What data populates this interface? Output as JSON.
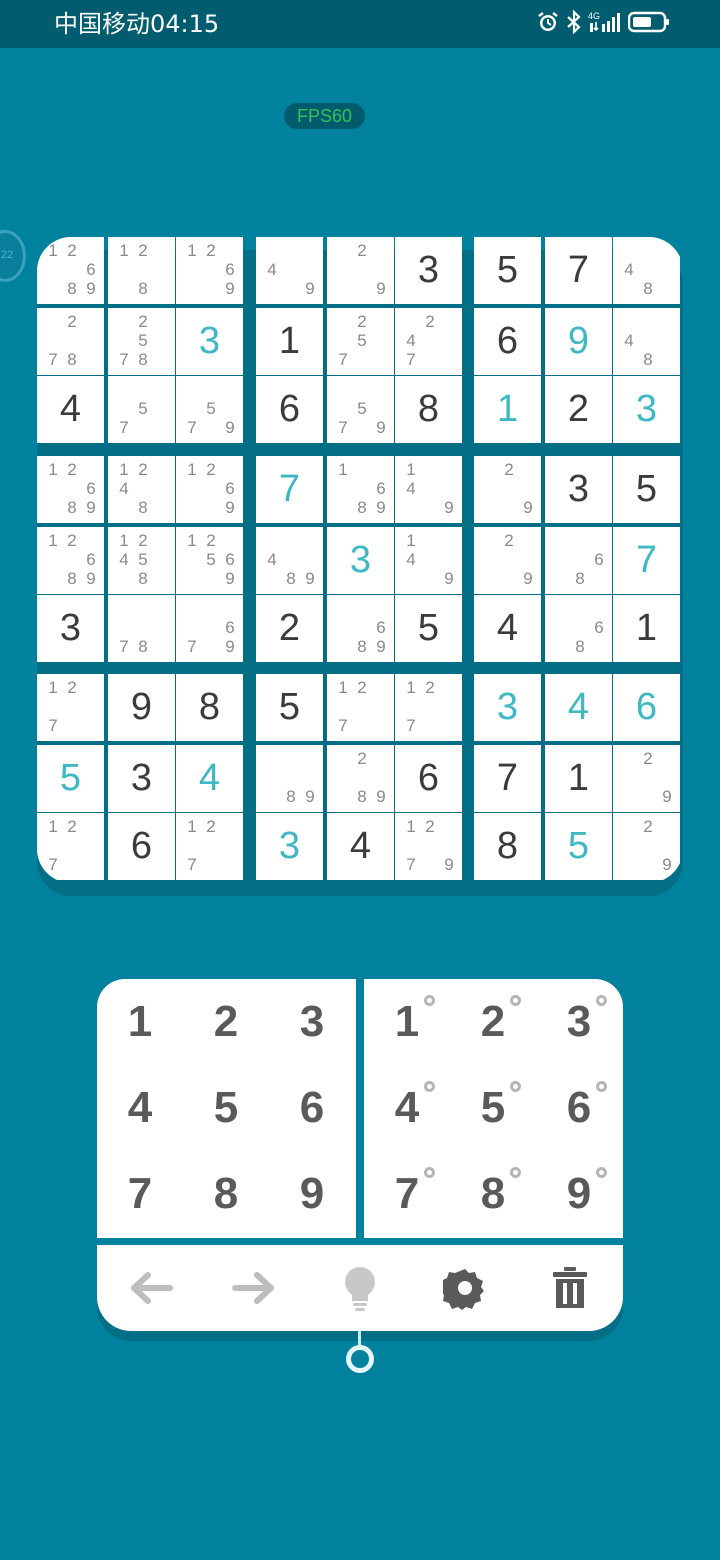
{
  "status_bar": {
    "carrier_time": "中国移动04:15",
    "icons": [
      "alarm-icon",
      "bluetooth-icon",
      "signal-4g-icon",
      "battery-icon"
    ],
    "network": "4G"
  },
  "fps_badge": "FPS60",
  "colors": {
    "background": "#00829f",
    "entered": "#3db8c4",
    "given": "#3b3b3b",
    "note": "#8a8a8a"
  },
  "board": {
    "rows": [
      [
        {
          "n": [
            1,
            2,
            6,
            8,
            9
          ]
        },
        {
          "n": [
            1,
            2,
            8
          ]
        },
        {
          "n": [
            1,
            2,
            6,
            9
          ]
        },
        {
          "n": [
            4,
            9
          ]
        },
        {
          "n": [
            2,
            9
          ]
        },
        {
          "v": "3",
          "t": "g"
        },
        {
          "v": "5",
          "t": "g"
        },
        {
          "v": "7",
          "t": "g"
        },
        {
          "n": [
            4,
            8
          ]
        }
      ],
      [
        {
          "n": [
            2,
            7,
            8
          ]
        },
        {
          "n": [
            2,
            5,
            7,
            8
          ]
        },
        {
          "v": "3",
          "t": "e"
        },
        {
          "v": "1",
          "t": "g"
        },
        {
          "n": [
            2,
            5,
            7
          ]
        },
        {
          "n": [
            2,
            4,
            7
          ]
        },
        {
          "v": "6",
          "t": "g"
        },
        {
          "v": "9",
          "t": "e"
        },
        {
          "n": [
            4,
            8
          ]
        }
      ],
      [
        {
          "v": "4",
          "t": "g"
        },
        {
          "n": [
            5,
            7
          ]
        },
        {
          "n": [
            5,
            7,
            9
          ]
        },
        {
          "v": "6",
          "t": "g"
        },
        {
          "n": [
            5,
            7,
            9
          ]
        },
        {
          "v": "8",
          "t": "g"
        },
        {
          "v": "1",
          "t": "e"
        },
        {
          "v": "2",
          "t": "g"
        },
        {
          "v": "3",
          "t": "e"
        }
      ],
      [
        {
          "n": [
            1,
            2,
            6,
            8,
            9
          ]
        },
        {
          "n": [
            1,
            2,
            4,
            8
          ]
        },
        {
          "n": [
            1,
            2,
            6,
            9
          ]
        },
        {
          "v": "7",
          "t": "e"
        },
        {
          "n": [
            1,
            6,
            8,
            9
          ]
        },
        {
          "n": [
            1,
            4,
            9
          ]
        },
        {
          "n": [
            2,
            9
          ]
        },
        {
          "v": "3",
          "t": "g"
        },
        {
          "v": "5",
          "t": "g"
        }
      ],
      [
        {
          "n": [
            1,
            2,
            6,
            8,
            9
          ]
        },
        {
          "n": [
            1,
            2,
            4,
            5,
            8
          ]
        },
        {
          "n": [
            1,
            2,
            5,
            6,
            9
          ]
        },
        {
          "n": [
            4,
            8,
            9
          ]
        },
        {
          "v": "3",
          "t": "e"
        },
        {
          "n": [
            1,
            4,
            9
          ]
        },
        {
          "n": [
            2,
            9
          ]
        },
        {
          "n": [
            6,
            8
          ]
        },
        {
          "v": "7",
          "t": "e"
        }
      ],
      [
        {
          "v": "3",
          "t": "g"
        },
        {
          "n": [
            7,
            8
          ]
        },
        {
          "n": [
            6,
            7,
            9
          ]
        },
        {
          "v": "2",
          "t": "g"
        },
        {
          "n": [
            6,
            8,
            9
          ]
        },
        {
          "v": "5",
          "t": "g"
        },
        {
          "v": "4",
          "t": "g"
        },
        {
          "n": [
            6,
            8
          ]
        },
        {
          "v": "1",
          "t": "g"
        }
      ],
      [
        {
          "n": [
            1,
            2,
            7
          ]
        },
        {
          "v": "9",
          "t": "g"
        },
        {
          "v": "8",
          "t": "g"
        },
        {
          "v": "5",
          "t": "g"
        },
        {
          "n": [
            1,
            2,
            7
          ]
        },
        {
          "n": [
            1,
            2,
            7
          ]
        },
        {
          "v": "3",
          "t": "e"
        },
        {
          "v": "4",
          "t": "e"
        },
        {
          "v": "6",
          "t": "e"
        }
      ],
      [
        {
          "v": "5",
          "t": "e"
        },
        {
          "v": "3",
          "t": "g"
        },
        {
          "v": "4",
          "t": "e"
        },
        {
          "n": [
            8,
            9
          ]
        },
        {
          "n": [
            2,
            8,
            9
          ]
        },
        {
          "v": "6",
          "t": "g"
        },
        {
          "v": "7",
          "t": "g"
        },
        {
          "v": "1",
          "t": "g"
        },
        {
          "n": [
            2,
            9
          ]
        }
      ],
      [
        {
          "n": [
            1,
            2,
            7
          ]
        },
        {
          "v": "6",
          "t": "g"
        },
        {
          "n": [
            1,
            2,
            7
          ]
        },
        {
          "v": "3",
          "t": "e"
        },
        {
          "v": "4",
          "t": "g"
        },
        {
          "n": [
            1,
            2,
            7,
            9
          ]
        },
        {
          "v": "8",
          "t": "g"
        },
        {
          "v": "5",
          "t": "e"
        },
        {
          "n": [
            2,
            9
          ]
        }
      ]
    ]
  },
  "number_pad": {
    "keys": [
      "1",
      "2",
      "3",
      "4",
      "5",
      "6",
      "7",
      "8",
      "9"
    ]
  },
  "note_pad": {
    "keys": [
      "1",
      "2",
      "3",
      "4",
      "5",
      "6",
      "7",
      "8",
      "9"
    ]
  },
  "toolbar": {
    "items": [
      "undo-icon",
      "redo-icon",
      "hint-icon",
      "settings-icon",
      "delete-icon"
    ]
  }
}
